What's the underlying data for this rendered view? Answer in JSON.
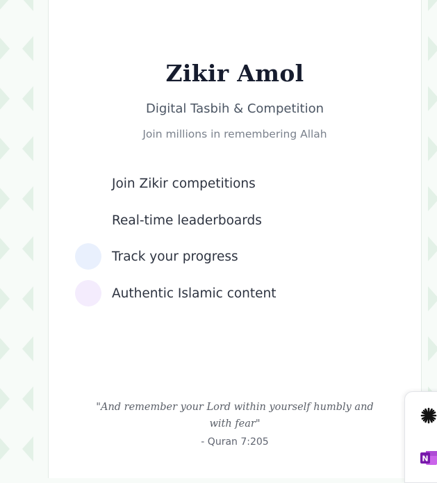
{
  "app": {
    "title": "Zikir Amol",
    "subtitle": "Digital Tasbih & Competition",
    "tagline": "Join millions in remembering Allah"
  },
  "features": [
    {
      "label": "Join Zikir competitions",
      "icon": "trophy-icon",
      "color": "#ffffff"
    },
    {
      "label": "Real-time leaderboards",
      "icon": "leaderboard-icon",
      "color": "#ffffff"
    },
    {
      "label": "Track your progress",
      "icon": "progress-icon",
      "color": "#e9f0fd"
    },
    {
      "label": "Authentic Islamic content",
      "icon": "book-icon",
      "color": "#f4ecfd"
    }
  ],
  "quote": {
    "text": "\"And remember your Lord within yourself humbly and with fear\"",
    "reference": "- Quran 7:205"
  },
  "dock": {
    "items": [
      {
        "icon": "asterisk-icon"
      },
      {
        "icon": "onenote-icon"
      }
    ]
  },
  "colors": {
    "background": "#f7fbf8",
    "pattern": "#e3f1e7",
    "title": "#161c2e",
    "onenote": "#7719aa"
  }
}
